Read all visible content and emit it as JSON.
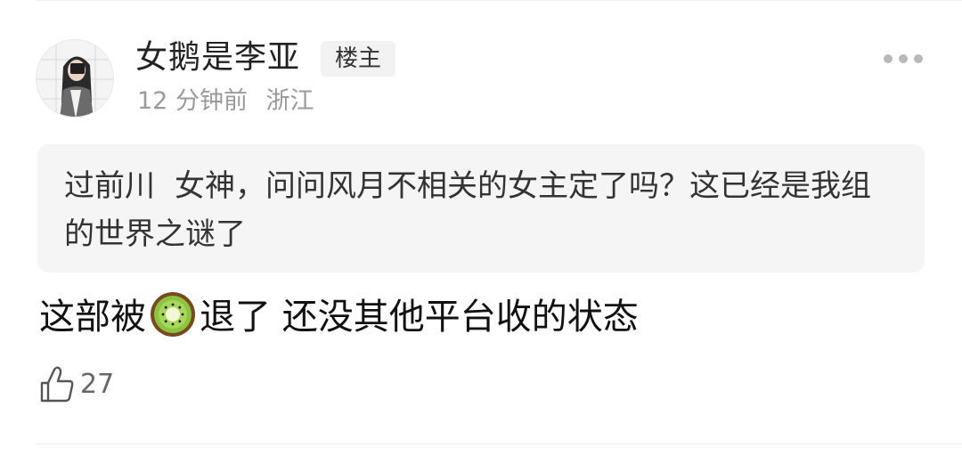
{
  "comment": {
    "username": "女鹅是李亚",
    "badge": "楼主",
    "time": "12 分钟前",
    "location": "浙江",
    "quote": {
      "user": "过前川",
      "text": "女神，问问风月不相关的女主定了吗？这已经是我组的世界之谜了"
    },
    "body_before_emoji": "这部被",
    "emoji": "kiwi-emoji",
    "body_after_emoji": "退了 还没其他平台收的状态",
    "likes": "27",
    "icons": {
      "more": "more-dots-icon",
      "like": "thumbs-up-icon"
    },
    "colors": {
      "meta_text": "#9a9a9a",
      "quote_bg": "#f5f5f5",
      "badge_bg": "#f2f2f2"
    }
  }
}
